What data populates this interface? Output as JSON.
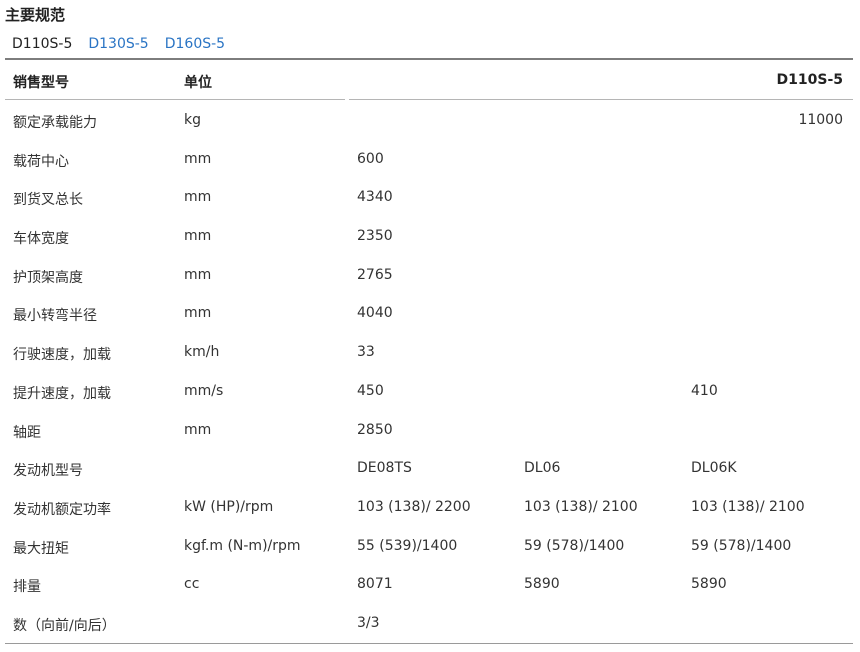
{
  "title": "主要规范",
  "tabs": [
    "D110S-5",
    "D130S-5",
    "D160S-5"
  ],
  "header": {
    "col1": "销售型号",
    "col2": "单位",
    "col_model": "D110S-5"
  },
  "capacity_row": {
    "label": "额定承载能力",
    "unit": "kg",
    "value": "11000"
  },
  "rows": [
    {
      "label": "载荷中心",
      "unit": "mm",
      "v1": "600",
      "v2": "",
      "v3": ""
    },
    {
      "label": "到货叉总长",
      "unit": "mm",
      "v1": "4340",
      "v2": "",
      "v3": ""
    },
    {
      "label": "车体宽度",
      "unit": "mm",
      "v1": "2350",
      "v2": "",
      "v3": ""
    },
    {
      "label": "护顶架高度",
      "unit": "mm",
      "v1": "2765",
      "v2": "",
      "v3": ""
    },
    {
      "label": "最小转弯半径",
      "unit": "mm",
      "v1": "4040",
      "v2": "",
      "v3": ""
    },
    {
      "label": "行驶速度，加载",
      "unit": "km/h",
      "v1": "33",
      "v2": "",
      "v3": ""
    },
    {
      "label": "提升速度，加载",
      "unit": "mm/s",
      "v1": "450",
      "v2": "",
      "v3": "410"
    },
    {
      "label": "轴距",
      "unit": "mm",
      "v1": "2850",
      "v2": "",
      "v3": ""
    },
    {
      "label": "发动机型号",
      "unit": "",
      "v1": "DE08TS",
      "v2": "DL06",
      "v3": "DL06K"
    },
    {
      "label": "发动机额定功率",
      "unit": "kW (HP)/rpm",
      "v1": "103 (138)/ 2200",
      "v2": "103 (138)/ 2100",
      "v3": "103 (138)/ 2100"
    },
    {
      "label": "最大扭矩",
      "unit": "kgf.m (N-m)/rpm",
      "v1": "55 (539)/1400",
      "v2": "59 (578)/1400",
      "v3": "59 (578)/1400"
    },
    {
      "label": "排量",
      "unit": "cc",
      "v1": "8071",
      "v2": "5890",
      "v3": "5890"
    },
    {
      "label": "数（向前/向后）",
      "unit": "",
      "v1": "3/3",
      "v2": "",
      "v3": ""
    }
  ],
  "colors": {
    "text": "#333333",
    "link": "#2a74c4",
    "rule": "#7d7d7d"
  }
}
